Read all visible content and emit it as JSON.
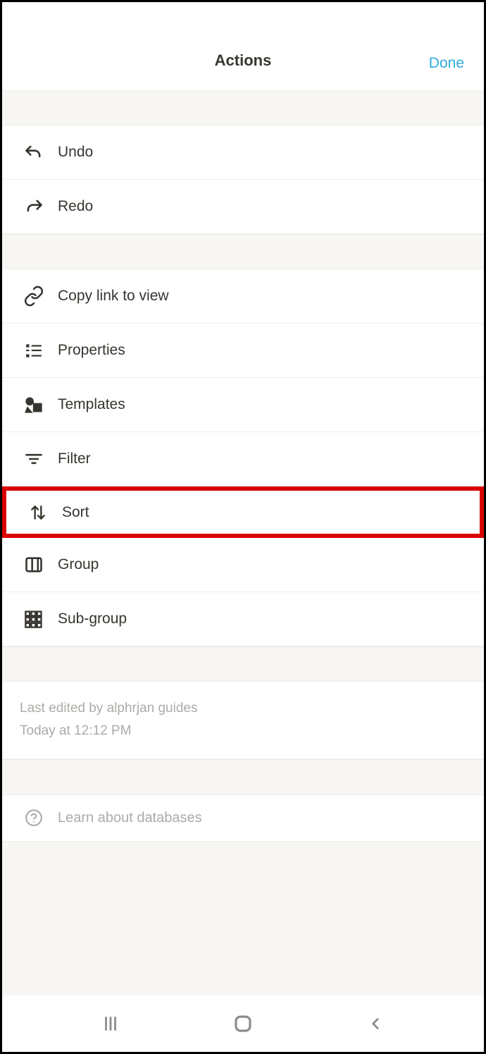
{
  "header": {
    "title": "Actions",
    "done": "Done"
  },
  "items": {
    "undo": "Undo",
    "redo": "Redo",
    "copyLink": "Copy link to view",
    "properties": "Properties",
    "templates": "Templates",
    "filter": "Filter",
    "sort": "Sort",
    "group": "Group",
    "subGroup": "Sub-group"
  },
  "meta": {
    "editedBy": "Last edited by alphrjan guides",
    "editedTime": "Today at 12:12 PM"
  },
  "learn": "Learn about databases"
}
